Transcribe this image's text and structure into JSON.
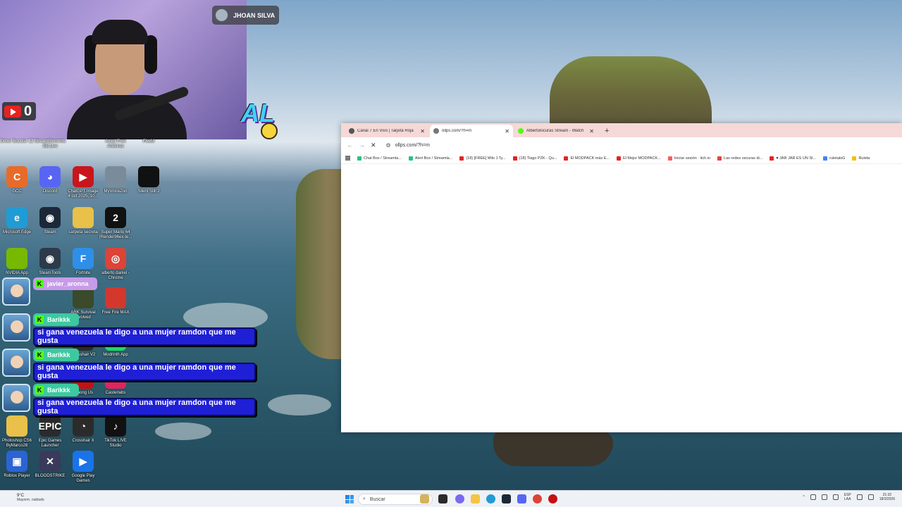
{
  "webcam": {
    "streamer_name": "JHOAN SILVA",
    "youtube_count": "0",
    "logo_text": "AL"
  },
  "desktop_icons": [
    {
      "label": "Driver Booster 12",
      "color": "#2a6fd6",
      "glyph": ""
    },
    {
      "label": "StreamElements SE.Live",
      "color": "#3b3b8c",
      "glyph": ""
    },
    {
      "label": "Avast Free Antivirus",
      "color": "#f47a20",
      "glyph": ""
    },
    {
      "label": "FiveM",
      "color": "#f2672a",
      "glyph": ""
    },
    {
      "label": "GCC",
      "color": "#e86b2a",
      "glyph": "C"
    },
    {
      "label": "Discord",
      "color": "#5865f2",
      "glyph": "◕"
    },
    {
      "label": "ChatGPT Image 4 oct 2025, 10...",
      "color": "#c8161c",
      "glyph": "▶"
    },
    {
      "label": "MyVoiceZoo",
      "color": "#7a8c9c",
      "glyph": ""
    },
    {
      "label": "Silent Still 2",
      "color": "#111111",
      "glyph": ""
    },
    {
      "label": "Microsoft Edge",
      "color": "#1f9cd6",
      "glyph": "e"
    },
    {
      "label": "Steam",
      "color": "#1b2838",
      "glyph": "◉"
    },
    {
      "label": "carpeta secreta",
      "color": "#e8c04a",
      "glyph": ""
    },
    {
      "label": "Super Mario 64 (Render96ex-te...",
      "color": "#111111",
      "glyph": "2"
    },
    {
      "label": "NVIDIA App",
      "color": "#76b900",
      "glyph": ""
    },
    {
      "label": "SteamTools",
      "color": "#2d3a4a",
      "glyph": "◉"
    },
    {
      "label": "Fortnite",
      "color": "#2f8fe8",
      "glyph": "F"
    },
    {
      "label": "alberto daniel - Chrome",
      "color": "#db4437",
      "glyph": "◎"
    },
    {
      "label": "ARK Survival Evolved",
      "color": "#3a4a2a",
      "glyph": ""
    },
    {
      "label": "Free Fire MAX",
      "color": "#d4372c",
      "glyph": ""
    },
    {
      "label": "Crosshair V2",
      "color": "#2b2b2b",
      "glyph": ""
    },
    {
      "label": "Modrinth App",
      "color": "#1bd96a",
      "glyph": ""
    },
    {
      "label": "Among Us",
      "color": "#c51111",
      "glyph": ""
    },
    {
      "label": "Casterlabs",
      "color": "#e0245e",
      "glyph": ""
    },
    {
      "label": "Photoshop CS6 ByMarco28",
      "color": "#e8c04a",
      "glyph": ""
    },
    {
      "label": "Epic Games Launcher",
      "color": "#2a2a2a",
      "glyph": "EPIC"
    },
    {
      "label": "Crosshair X",
      "color": "#2b2b2b",
      "glyph": "◔"
    },
    {
      "label": "TikTok LIVE Studio",
      "color": "#111111",
      "glyph": "♪"
    },
    {
      "label": "Roblox Player",
      "color": "#2b63d4",
      "glyph": "▣"
    },
    {
      "label": "BLOODSTRIKE",
      "color": "#3a3a5a",
      "glyph": "✕"
    },
    {
      "label": "Google Play Games",
      "color": "#1a73e8",
      "glyph": "▶"
    }
  ],
  "chat": [
    {
      "user": "javier_aronna",
      "message": "",
      "name_color": "#c79be8"
    },
    {
      "user": "Barikkk",
      "message": "si gana venezuela le digo a una mujer ramdon que me gusta",
      "name_color": "#3cc9a0"
    },
    {
      "user": "Barikkk",
      "message": "si gana venezuela le digo a una mujer ramdon que me gusta",
      "name_color": "#3cc9a0"
    },
    {
      "user": "Barikkk",
      "message": "si gana venezuela le digo a una mujer ramdon que me gusta",
      "name_color": "#3cc9a0"
    }
  ],
  "browser": {
    "tabs": [
      {
        "title": "Canal 7 En Vivo | Tarjeta Roja",
        "active": false,
        "favicon_color": "#555555"
      },
      {
        "title": "ollps.com/?h=m",
        "active": true,
        "favicon_color": "#777777"
      },
      {
        "title": "Albertolocuras Stream - Watch",
        "active": false,
        "favicon_color": "#53fc18"
      }
    ],
    "address": "ollps.com/?h=m",
    "bookmarks": [
      {
        "label": "Chat Box / Streamla...",
        "color": "#26c281"
      },
      {
        "label": "Alert Box / Streamla...",
        "color": "#26c281"
      },
      {
        "label": "(18) [FREE] Milo J Ty...",
        "color": "#e52420"
      },
      {
        "label": "(18) Tiago PZK - Qu...",
        "color": "#e52420"
      },
      {
        "label": "El MODPACK más E...",
        "color": "#e52420"
      },
      {
        "label": "El Mejor MODPACK...",
        "color": "#e52420"
      },
      {
        "label": "Iniciar sesión · itch.io",
        "color": "#fa5c5c"
      },
      {
        "label": "Las redes oscuras di...",
        "color": "#e84040"
      },
      {
        "label": "♥ JAR JAR ES UN SI...",
        "color": "#e52420"
      },
      {
        "label": "ruletaloG",
        "color": "#4285f4"
      },
      {
        "label": "Ruleta",
        "color": "#fbbc05"
      }
    ]
  },
  "taskbar": {
    "weather_temp": "9°C",
    "weather_desc": "Mayorm. nublado",
    "search_placeholder": "Buscar",
    "lang_top": "ESP",
    "lang_bottom": "LAA",
    "time": "21:32",
    "date": "18/3/2026"
  }
}
